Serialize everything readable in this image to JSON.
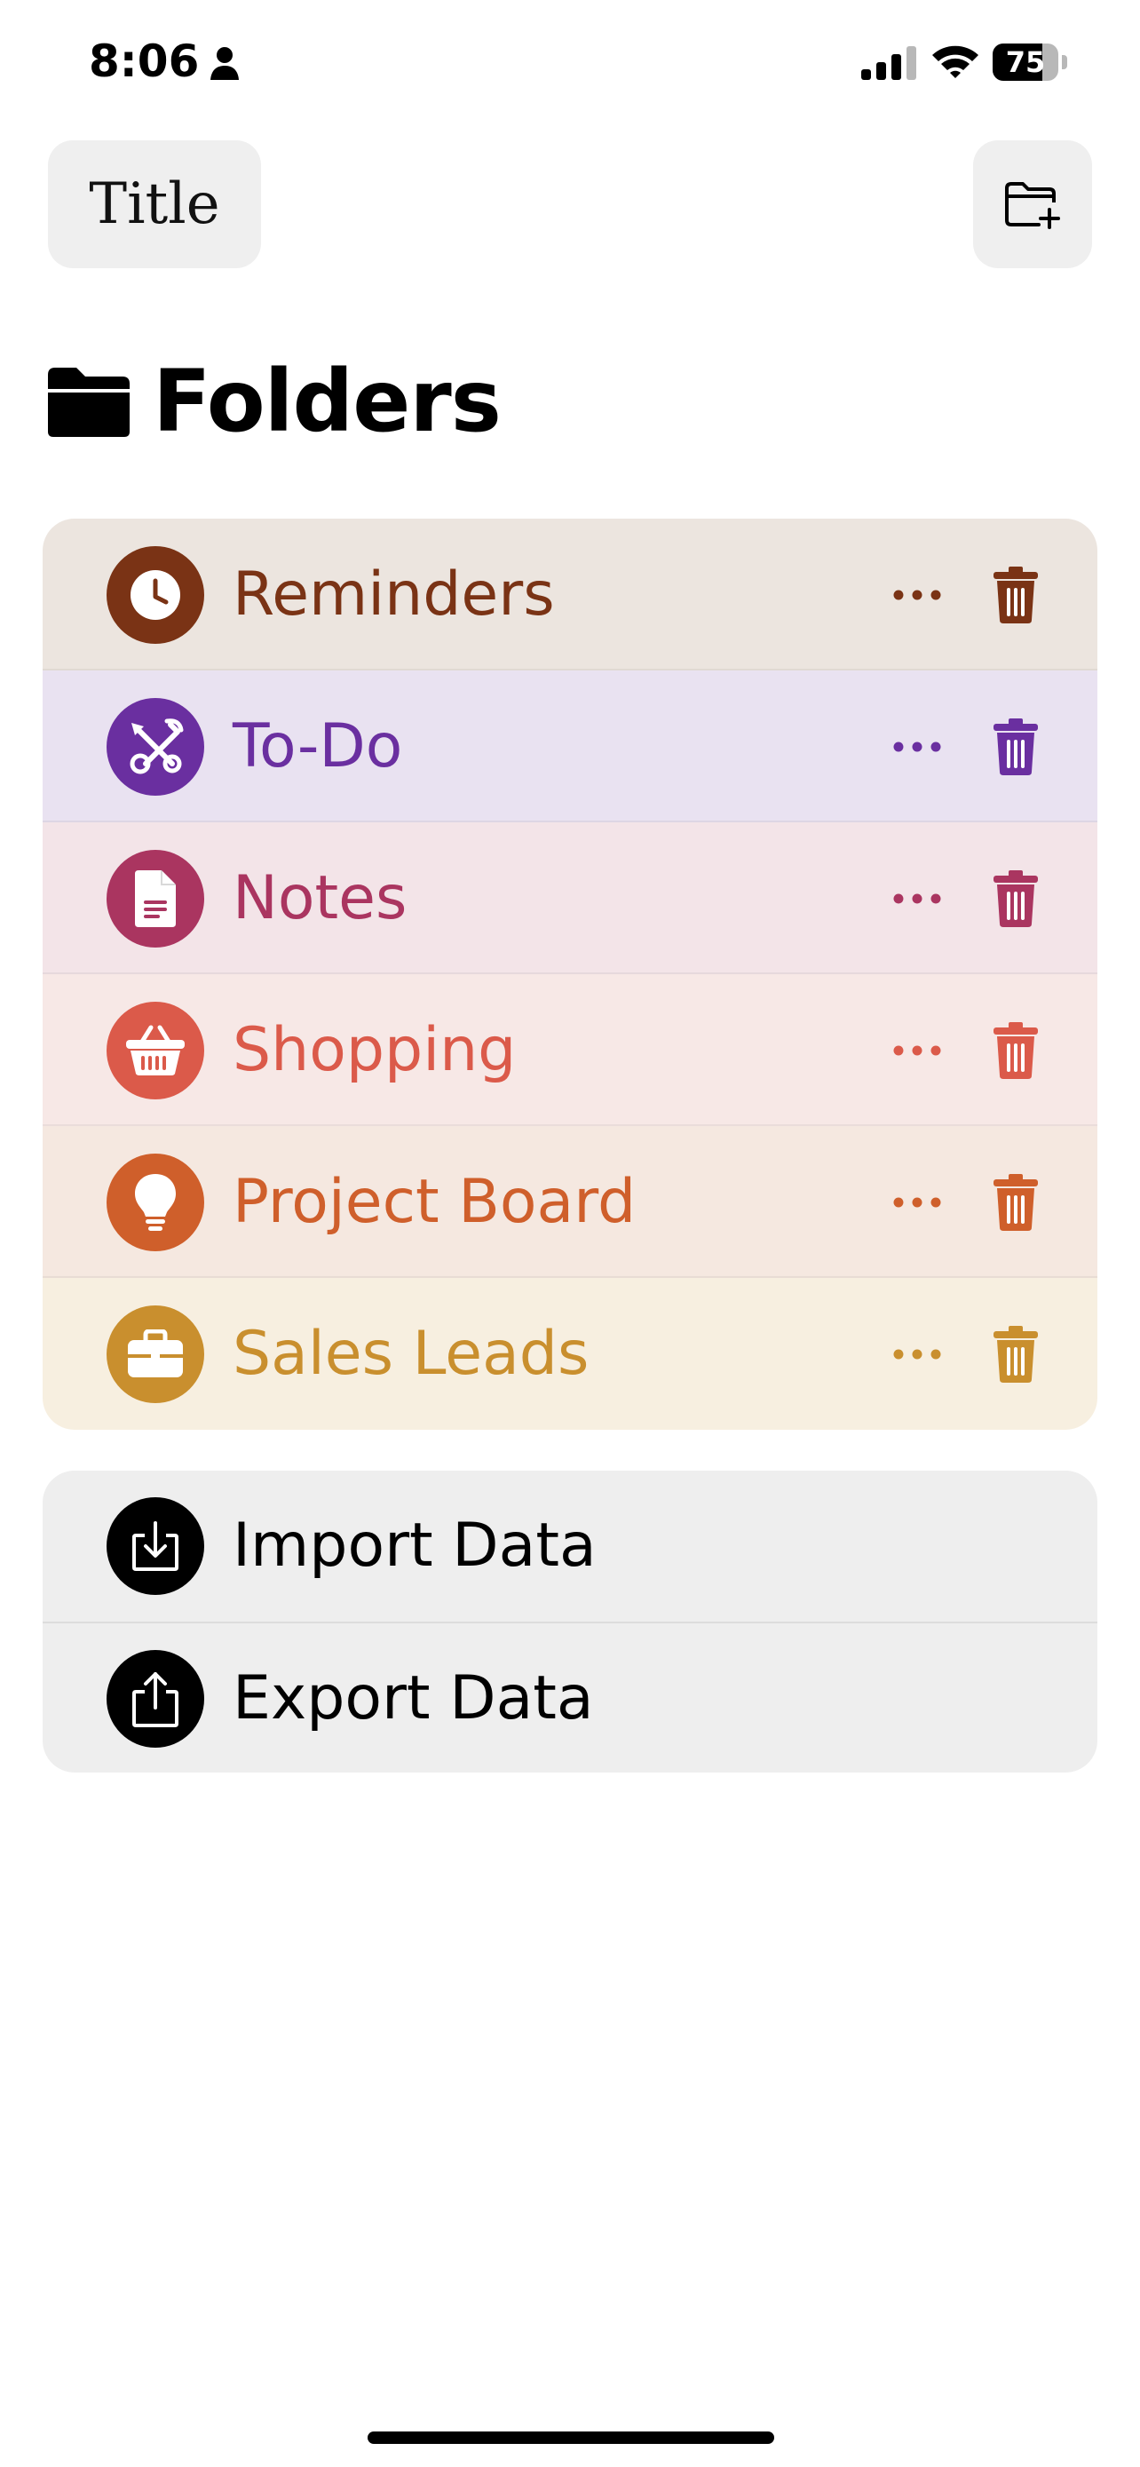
{
  "status_bar": {
    "time": "8:06",
    "battery_text": "75",
    "battery_level": 0.75
  },
  "toolbar": {
    "title_button_label": "Title",
    "new_folder_icon": "folder-plus-icon"
  },
  "header": {
    "title": "Folders",
    "icon": "folder-icon"
  },
  "folders": [
    {
      "label": "Reminders",
      "icon": "clock-icon",
      "color": "#7a3315",
      "bg": "#ece5df"
    },
    {
      "label": "To-Do",
      "icon": "tools-icon",
      "color": "#6a2fa0",
      "bg": "#e9e2f1"
    },
    {
      "label": "Notes",
      "icon": "document-icon",
      "color": "#aa3560",
      "bg": "#f3e4e8"
    },
    {
      "label": "Shopping",
      "icon": "basket-icon",
      "color": "#db5a4a",
      "bg": "#f7e8e6"
    },
    {
      "label": "Project Board",
      "icon": "lightbulb-icon",
      "color": "#cf5f2b",
      "bg": "#f5e8e0"
    },
    {
      "label": "Sales Leads",
      "icon": "briefcase-icon",
      "color": "#c98f2e",
      "bg": "#f7efe0"
    }
  ],
  "actions": [
    {
      "label": "Import Data",
      "icon": "import-icon"
    },
    {
      "label": "Export Data",
      "icon": "export-icon"
    }
  ]
}
